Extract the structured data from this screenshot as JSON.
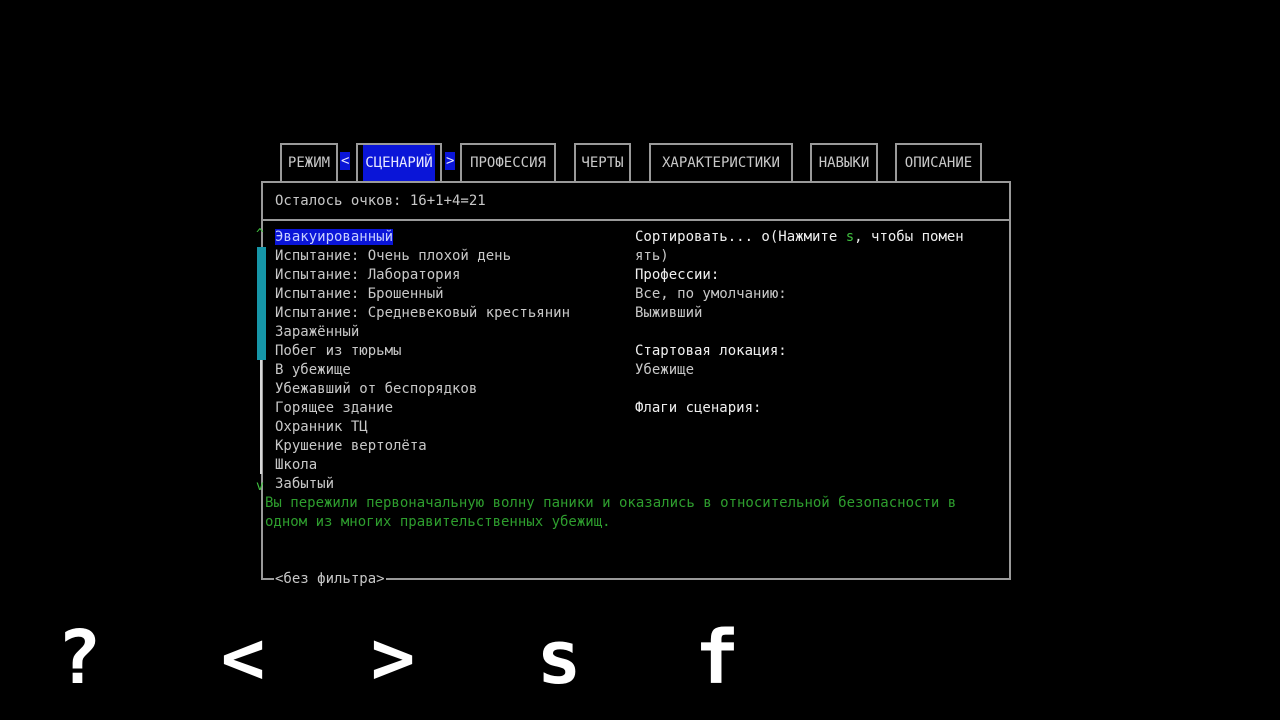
{
  "tabs": [
    {
      "label": "РЕЖИМ",
      "active": false
    },
    {
      "label": "СЦЕНАРИЙ",
      "active": true,
      "prev_arrow": "<",
      "next_arrow": ">"
    },
    {
      "label": "ПРОФЕССИЯ",
      "active": false
    },
    {
      "label": "ЧЕРТЫ",
      "active": false
    },
    {
      "label": "ХАРАКТЕРИСТИКИ",
      "active": false
    },
    {
      "label": "НАВЫКИ",
      "active": false
    },
    {
      "label": "ОПИСАНИЕ",
      "active": false
    }
  ],
  "points_text": "Осталось очков: 16+1+4=21",
  "scenarios": [
    "Эвакуированный",
    "Испытание: Очень плохой день",
    "Испытание: Лаборатория",
    "Испытание: Брошенный",
    "Испытание: Средневековый крестьянин",
    "Заражённый",
    "Побег из тюрьмы",
    "В убежище",
    "Убежавший от беспорядков",
    "Горящее здание",
    "Охранник ТЦ",
    "Крушение вертолёта",
    "Школа",
    "Забытый"
  ],
  "selected_index": 0,
  "scroll": {
    "up": "^",
    "down": "v"
  },
  "details": {
    "sort_prefix": "Сортировать... o(Нажмите ",
    "sort_key": "s",
    "sort_suffix": ", чтобы помен",
    "sort_wrap": "ять)",
    "professions_label": "Профессии:",
    "professions_default": "Все, по умолчанию:",
    "professions_value": "Выживший",
    "start_location_label": "Стартовая локация:",
    "start_location_value": "Убежище",
    "flags_label": "Флаги сценария:"
  },
  "description": "Вы пережили первоначальную волну паники и оказались в относительной безопасности в одном из многих правительственных убежищ.",
  "filter_text": "<без фильтра>",
  "buttons": {
    "help": "?",
    "prev": "<",
    "next": ">",
    "sort": "s",
    "filter": "f"
  },
  "colors": {
    "highlight": "#0a15d8",
    "scroll_thumb": "#1696a8",
    "description": "#2e9e2e",
    "key_hint": "#3fbf3f"
  }
}
